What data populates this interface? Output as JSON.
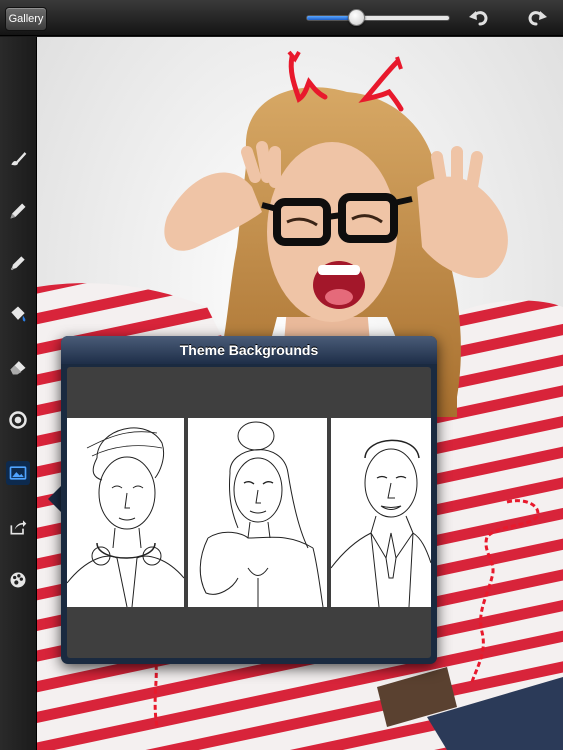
{
  "toolbar": {
    "gallery_label": "Gallery",
    "brush_size_fraction": 0.35,
    "undo_icon": "undo-icon",
    "redo_icon": "redo-icon"
  },
  "sidebar": {
    "tools": [
      {
        "name": "brush-icon",
        "active": false
      },
      {
        "name": "pencil-icon",
        "active": false
      },
      {
        "name": "pen-icon",
        "active": false
      },
      {
        "name": "paint-bucket-icon",
        "active": false
      },
      {
        "name": "eraser-icon",
        "active": false
      },
      {
        "name": "color-wheel-icon",
        "active": false
      },
      {
        "name": "image-background-icon",
        "active": true
      },
      {
        "name": "share-icon",
        "active": false
      },
      {
        "name": "palette-icon",
        "active": false
      }
    ]
  },
  "popover": {
    "title": "Theme Backgrounds",
    "thumbnails": [
      "boy-with-headphones",
      "woman-with-hair-bun",
      "man-in-suit"
    ]
  },
  "colors": {
    "accent": "#2a7be0",
    "doodle_red": "#e8192c",
    "popover_frame": "#1a2a40"
  }
}
